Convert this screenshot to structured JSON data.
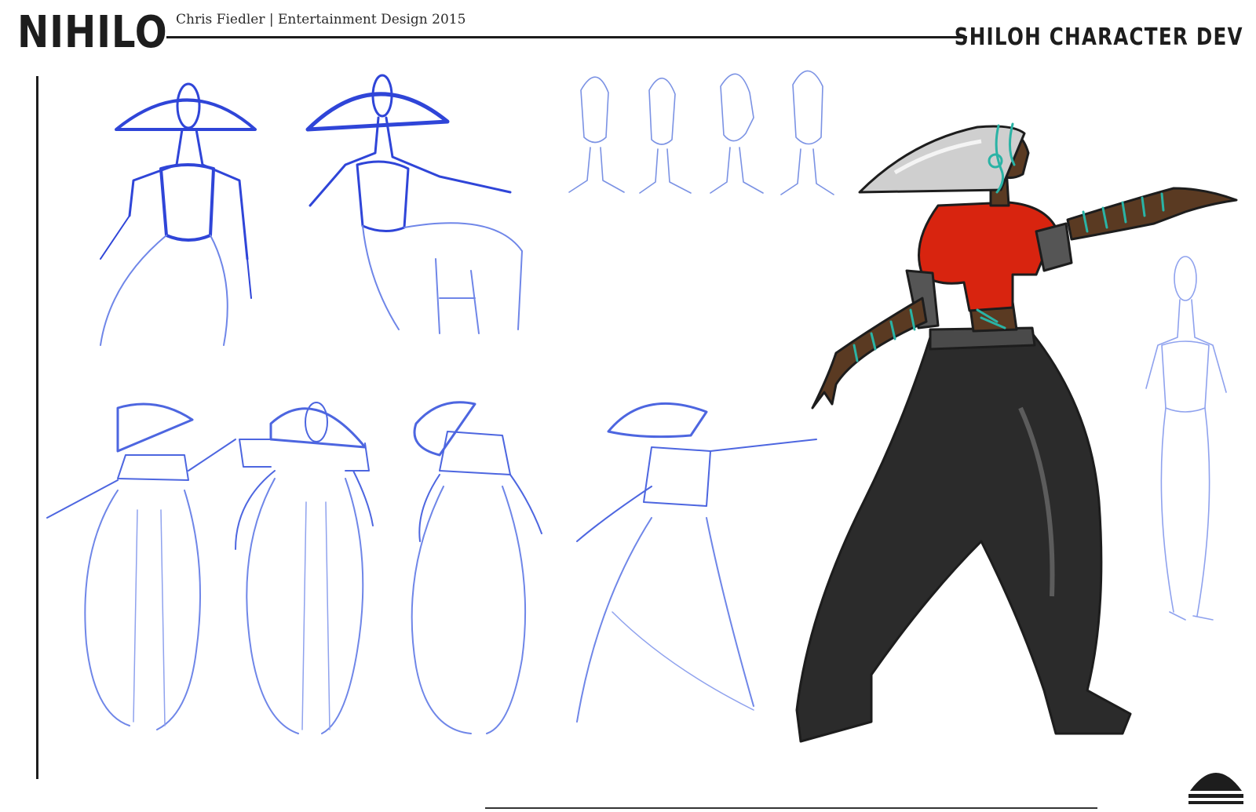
{
  "header": {
    "logo": "NIHILO",
    "credit": "Chris Fiedler | Entertainment Design 2015",
    "sheet_title": "SHILOH CHARACTER DEV"
  },
  "colors": {
    "sketch_blue": "#2f45d8",
    "sketch_light_blue": "#6f86e8",
    "shirt_red": "#d8240f",
    "pants_black": "#2b2b2b",
    "skin_brown": "#5a3a22",
    "hat_grey": "#cfcfcf",
    "tattoo_teal": "#2ab3a5",
    "ink_dark": "#1d1d1d"
  },
  "icons": {
    "stamp": "dome-stamp-icon"
  }
}
